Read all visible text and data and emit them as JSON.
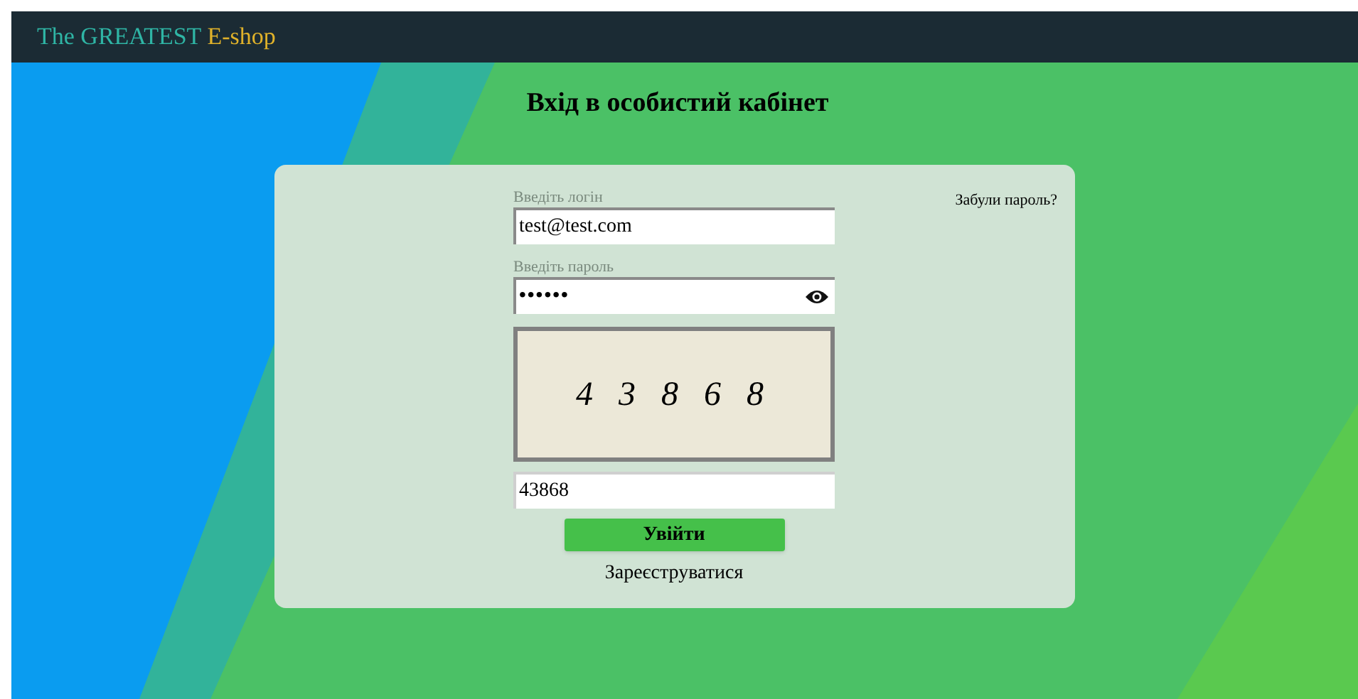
{
  "header": {
    "brand_name": "The GREATEST",
    "brand_suffix": "E-shop"
  },
  "title": "Вхід в особистий кабінет",
  "forgot_link": "Забули пароль?",
  "login": {
    "label": "Введіть логін",
    "value": "test@test.com"
  },
  "password": {
    "label": "Введіть пароль",
    "value": "••••••"
  },
  "captcha": {
    "code": "4 3 8 6 8"
  },
  "captcha_input": {
    "value": "43868"
  },
  "submit_button": "Увійти",
  "register_link": "Зареєструватися"
}
